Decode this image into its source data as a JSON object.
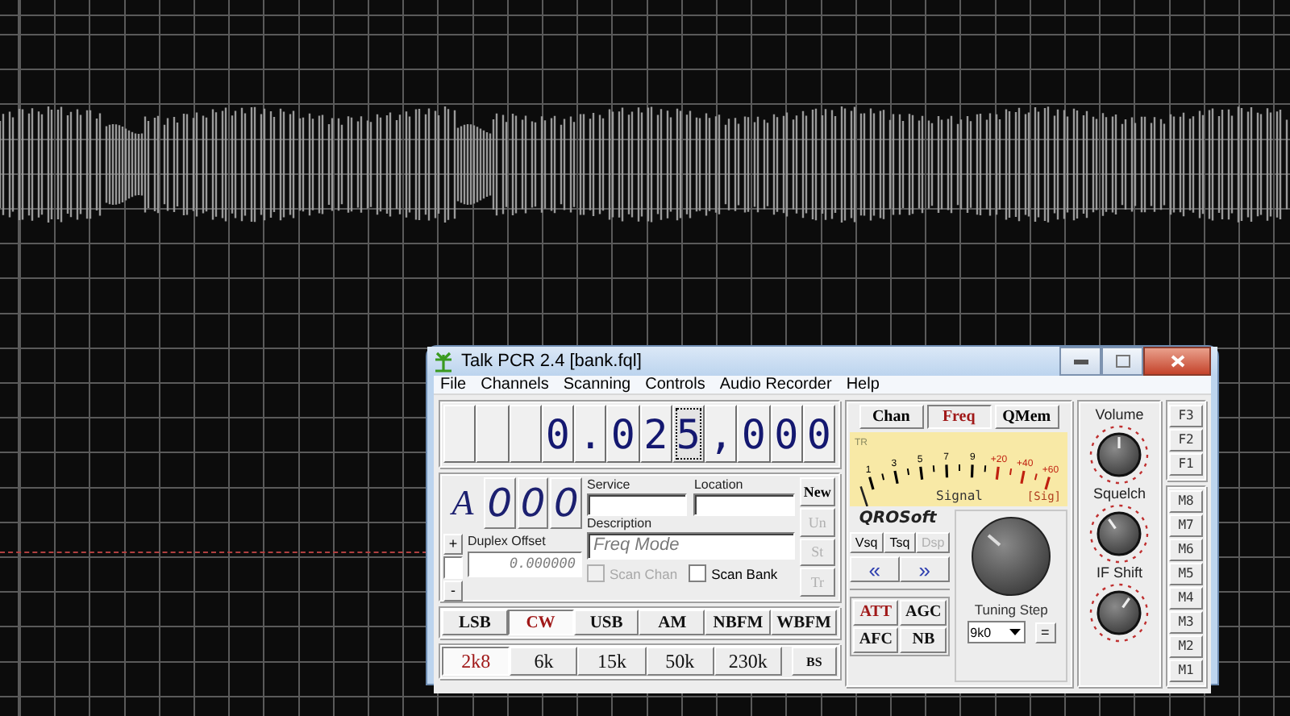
{
  "window": {
    "title": "Talk PCR 2.4 [bank.fql]"
  },
  "menu": [
    {
      "label": "File"
    },
    {
      "label": "Channels"
    },
    {
      "label": "Scanning"
    },
    {
      "label": "Controls"
    },
    {
      "label": "Audio Recorder"
    },
    {
      "label": "Help"
    }
  ],
  "frequency": {
    "cells": [
      {
        "kind": "blank",
        "focused": false
      },
      {
        "kind": "blank",
        "focused": false
      },
      {
        "kind": "blank",
        "focused": false
      },
      {
        "kind": "digit",
        "text": "0",
        "focused": false
      },
      {
        "kind": "separator",
        "text": ".",
        "focused": false
      },
      {
        "kind": "digit",
        "text": "0",
        "focused": false
      },
      {
        "kind": "digit",
        "text": "2",
        "focused": false
      },
      {
        "kind": "digit",
        "text": "5",
        "focused": true
      },
      {
        "kind": "separator",
        "text": ",",
        "focused": false
      },
      {
        "kind": "digit",
        "text": "0",
        "focused": false
      },
      {
        "kind": "digit",
        "text": "0",
        "focused": false
      },
      {
        "kind": "digit",
        "text": "0",
        "focused": false
      }
    ]
  },
  "channel": {
    "bank": "A",
    "digits": [
      "0",
      "0",
      "0"
    ]
  },
  "duplex": {
    "plus": "+",
    "minus": "-",
    "label": "Duplex Offset",
    "value": "0.000000"
  },
  "fields": {
    "service": {
      "label": "Service"
    },
    "location": {
      "label": "Location"
    },
    "description": {
      "label": "Description",
      "value": "Freq Mode"
    }
  },
  "checks": [
    {
      "label": "Scan Chan",
      "checked": false,
      "disabled": true
    },
    {
      "label": "Scan Bank",
      "checked": false,
      "disabled": false
    }
  ],
  "side_buttons": [
    {
      "label": "New",
      "disabled": false
    },
    {
      "label": "Un",
      "disabled": true
    },
    {
      "label": "St",
      "disabled": true
    },
    {
      "label": "Tr",
      "disabled": true
    }
  ],
  "modes": [
    {
      "label": "LSB",
      "selected": false
    },
    {
      "label": "CW",
      "selected": true
    },
    {
      "label": "USB",
      "selected": false
    },
    {
      "label": "AM",
      "selected": false
    },
    {
      "label": "NBFM",
      "selected": false
    },
    {
      "label": "WBFM",
      "selected": false
    }
  ],
  "filters": [
    {
      "label": "2k8",
      "selected": true
    },
    {
      "label": "6k",
      "selected": false
    },
    {
      "label": "15k",
      "selected": false
    },
    {
      "label": "50k",
      "selected": false
    },
    {
      "label": "230k",
      "selected": false
    }
  ],
  "bs_button": "BS",
  "views": [
    {
      "label": "Chan",
      "selected": false
    },
    {
      "label": "Freq",
      "selected": true
    },
    {
      "label": "QMem",
      "selected": false
    }
  ],
  "meter": {
    "corner": "TR",
    "level": 0,
    "caption": "Signal",
    "tag": "[Sig]",
    "scale": [
      {
        "text": "1",
        "kind": "normal"
      },
      {
        "text": "3",
        "kind": "normal"
      },
      {
        "text": "5",
        "kind": "normal"
      },
      {
        "text": "7",
        "kind": "normal"
      },
      {
        "text": "9",
        "kind": "normal"
      },
      {
        "text": "+20",
        "kind": "over"
      },
      {
        "text": "+40",
        "kind": "over"
      },
      {
        "text": "+60",
        "kind": "over"
      }
    ]
  },
  "logo": "QROSoft",
  "squelch_modes": [
    {
      "label": "Vsq",
      "disabled": false
    },
    {
      "label": "Tsq",
      "disabled": false
    },
    {
      "label": "Dsp",
      "disabled": true
    }
  ],
  "arrows": [
    "«",
    "»"
  ],
  "toggles": [
    {
      "label": "ATT",
      "on": true
    },
    {
      "label": "AGC",
      "on": false
    },
    {
      "label": "AFC",
      "on": false
    },
    {
      "label": "NB",
      "on": false
    }
  ],
  "tuning": {
    "label": "Tuning Step",
    "step": "9k0",
    "equals": "="
  },
  "knobs": [
    {
      "label": "Volume"
    },
    {
      "label": "Squelch"
    },
    {
      "label": "IF Shift"
    }
  ],
  "f_buttons": [
    "F3",
    "F2",
    "F1"
  ],
  "m_buttons": [
    "M8",
    "M7",
    "M6",
    "M5",
    "M4",
    "M3",
    "M2",
    "M1"
  ]
}
